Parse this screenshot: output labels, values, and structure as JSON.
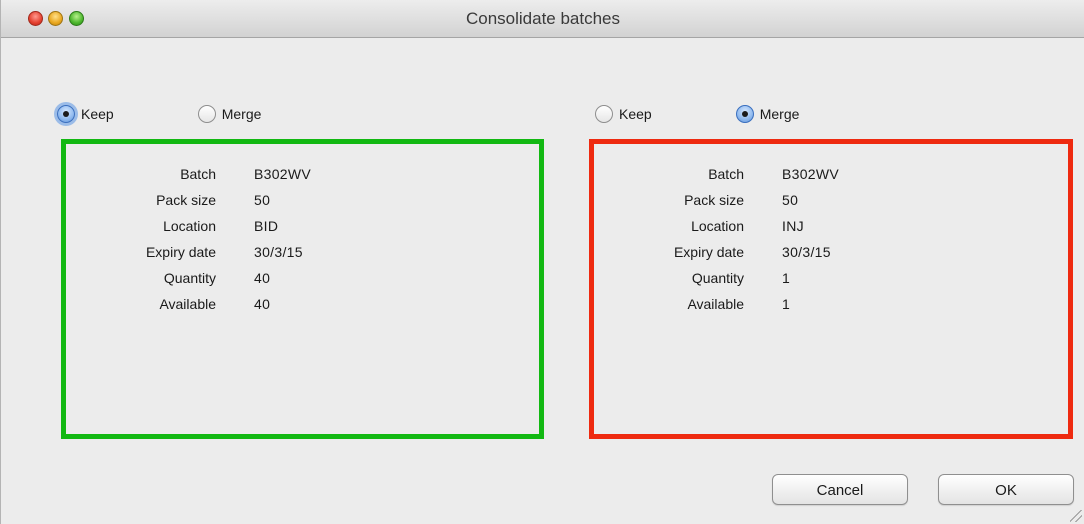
{
  "window": {
    "title": "Consolidate batches"
  },
  "left": {
    "keep_label": "Keep",
    "merge_label": "Merge",
    "selected": "Keep",
    "border_color": "#12b812",
    "fields": [
      {
        "label": "Batch",
        "value": "B302WV"
      },
      {
        "label": "Pack size",
        "value": "50"
      },
      {
        "label": "Location",
        "value": "BID"
      },
      {
        "label": "Expiry date",
        "value": "30/3/15"
      },
      {
        "label": "Quantity",
        "value": "40"
      },
      {
        "label": "Available",
        "value": "40"
      }
    ]
  },
  "right": {
    "keep_label": "Keep",
    "merge_label": "Merge",
    "selected": "Merge",
    "border_color": "#ee2a10",
    "fields": [
      {
        "label": "Batch",
        "value": "B302WV"
      },
      {
        "label": "Pack size",
        "value": "50"
      },
      {
        "label": "Location",
        "value": "INJ"
      },
      {
        "label": "Expiry date",
        "value": "30/3/15"
      },
      {
        "label": "Quantity",
        "value": "1"
      },
      {
        "label": "Available",
        "value": "1"
      }
    ]
  },
  "buttons": {
    "cancel_label": "Cancel",
    "ok_label": "OK"
  },
  "icons": {
    "close": "close-traffic-light-icon",
    "minimize": "minimize-traffic-light-icon",
    "zoom": "zoom-traffic-light-icon"
  }
}
